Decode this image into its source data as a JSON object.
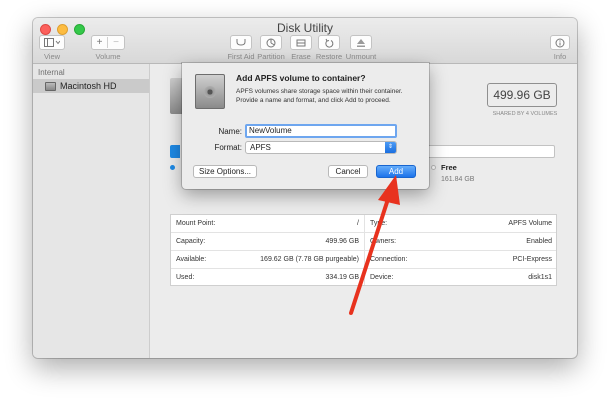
{
  "window": {
    "title": "Disk Utility"
  },
  "toolbar": {
    "view_label": "View",
    "volume_label": "Volume",
    "first_aid_label": "First Aid",
    "partition_label": "Partition",
    "erase_label": "Erase",
    "restore_label": "Restore",
    "unmount_label": "Unmount",
    "info_label": "Info",
    "add_glyph": "+",
    "remove_glyph": "−"
  },
  "sidebar": {
    "section_header": "Internal",
    "items": [
      {
        "label": "Macintosh HD"
      }
    ]
  },
  "volume": {
    "capacity": "499.96 GB",
    "shared_label": "SHARED BY 4 VOLUMES",
    "free_label": "Free",
    "free_value": "161.84 GB"
  },
  "info_table": {
    "left": [
      {
        "label": "Mount Point:",
        "value": "/"
      },
      {
        "label": "Capacity:",
        "value": "499.96 GB"
      },
      {
        "label": "Available:",
        "value": "169.62 GB (7.78 GB purgeable)"
      },
      {
        "label": "Used:",
        "value": "334.19 GB"
      }
    ],
    "right": [
      {
        "label": "Type:",
        "value": "APFS Volume"
      },
      {
        "label": "Owners:",
        "value": "Enabled"
      },
      {
        "label": "Connection:",
        "value": "PCI-Express"
      },
      {
        "label": "Device:",
        "value": "disk1s1"
      }
    ]
  },
  "dialog": {
    "title": "Add APFS volume to container?",
    "description": "APFS volumes share storage space within their container. Provide a name and format, and click Add to proceed.",
    "name_label": "Name:",
    "name_value": "NewVolume",
    "format_label": "Format:",
    "format_value": "APFS",
    "size_options_label": "Size Options...",
    "cancel_label": "Cancel",
    "add_label": "Add"
  },
  "colors": {
    "accent_blue": "#1c73ea",
    "annotation_arrow": "#e8321e"
  }
}
